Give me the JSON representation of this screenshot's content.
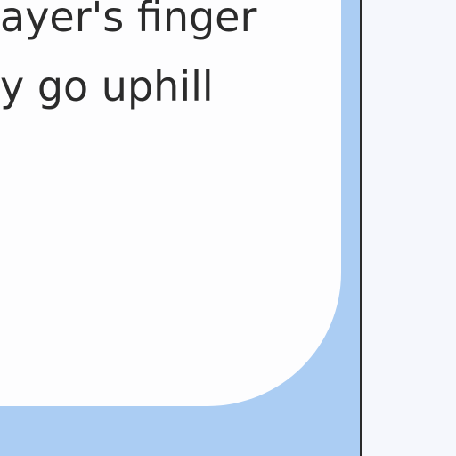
{
  "card": {
    "lines": [
      "ayer's finger",
      "y go uphill"
    ]
  }
}
